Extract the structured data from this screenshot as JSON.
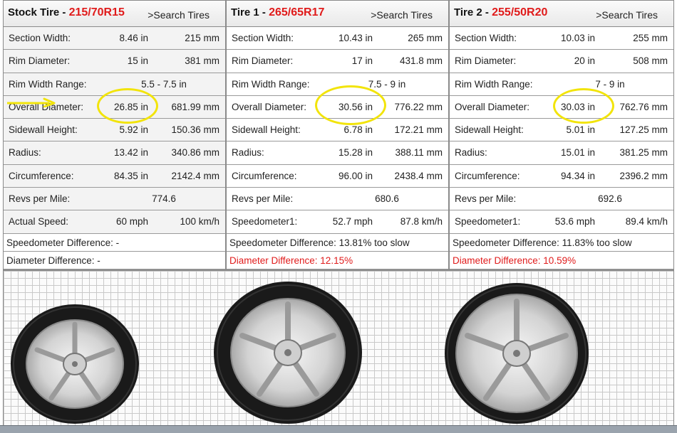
{
  "columns": [
    {
      "title": "Stock Tire - ",
      "size": "215/70R15",
      "search_label": ">Search Tires",
      "rows": [
        {
          "label": "Section Width:",
          "v1": "8.46 in",
          "v2": "215 mm"
        },
        {
          "label": "Rim Diameter:",
          "v1": "15 in",
          "v2": "381 mm"
        },
        {
          "label": "Rim Width Range:",
          "vc": "5.5 - 7.5 in"
        },
        {
          "label": "Overall Diameter:",
          "v1": "26.85 in",
          "v2": "681.99 mm"
        },
        {
          "label": "Sidewall Height:",
          "v1": "5.92 in",
          "v2": "150.36 mm"
        },
        {
          "label": "Radius:",
          "v1": "13.42 in",
          "v2": "340.86 mm"
        },
        {
          "label": "Circumference:",
          "v1": "84.35 in",
          "v2": "2142.4 mm"
        },
        {
          "label": "Revs per Mile:",
          "vc": "774.6"
        },
        {
          "label": "Actual Speed:",
          "v1": "60 mph",
          "v2": "100 km/h"
        }
      ],
      "speedometer_difference": "Speedometer Difference: -",
      "diameter_difference": "Diameter Difference: -"
    },
    {
      "title": "Tire 1 - ",
      "size": "265/65R17",
      "search_label": ">Search Tires",
      "rows": [
        {
          "label": "Section Width:",
          "v1": "10.43 in",
          "v2": "265 mm"
        },
        {
          "label": "Rim Diameter:",
          "v1": "17 in",
          "v2": "431.8 mm"
        },
        {
          "label": "Rim Width Range:",
          "vc": "7.5 - 9 in"
        },
        {
          "label": "Overall Diameter:",
          "v1": "30.56 in",
          "v2": "776.22 mm"
        },
        {
          "label": "Sidewall Height:",
          "v1": "6.78 in",
          "v2": "172.21 mm"
        },
        {
          "label": "Radius:",
          "v1": "15.28 in",
          "v2": "388.11 mm"
        },
        {
          "label": "Circumference:",
          "v1": "96.00 in",
          "v2": "2438.4 mm"
        },
        {
          "label": "Revs per Mile:",
          "vc": "680.6"
        },
        {
          "label": "Speedometer1:",
          "v1": "52.7 mph",
          "v2": "87.8 km/h"
        }
      ],
      "speedometer_difference": "Speedometer Difference: 13.81% too slow",
      "diameter_difference": "Diameter Difference: 12.15%"
    },
    {
      "title": "Tire 2 - ",
      "size": "255/50R20",
      "search_label": ">Search Tires",
      "rows": [
        {
          "label": "Section Width:",
          "v1": "10.03 in",
          "v2": "255 mm"
        },
        {
          "label": "Rim Diameter:",
          "v1": "20 in",
          "v2": "508 mm"
        },
        {
          "label": "Rim Width Range:",
          "vc": "7 - 9 in"
        },
        {
          "label": "Overall Diameter:",
          "v1": "30.03 in",
          "v2": "762.76 mm"
        },
        {
          "label": "Sidewall Height:",
          "v1": "5.01 in",
          "v2": "127.25 mm"
        },
        {
          "label": "Radius:",
          "v1": "15.01 in",
          "v2": "381.25 mm"
        },
        {
          "label": "Circumference:",
          "v1": "94.34 in",
          "v2": "2396.2 mm"
        },
        {
          "label": "Revs per Mile:",
          "vc": "692.6"
        },
        {
          "label": "Speedometer1:",
          "v1": "53.6 mph",
          "v2": "89.4 km/h"
        }
      ],
      "speedometer_difference": "Speedometer Difference: 11.83% too slow",
      "diameter_difference": "Diameter Difference: 10.59%"
    }
  ],
  "colors": {
    "accent_red": "#e01b1b",
    "highlight_yellow": "#f2e40a",
    "grid_line": "#c9c9c9"
  },
  "icons": [
    "tire-wheel-icon",
    "highlight-arrow-icon",
    "highlight-circle"
  ]
}
